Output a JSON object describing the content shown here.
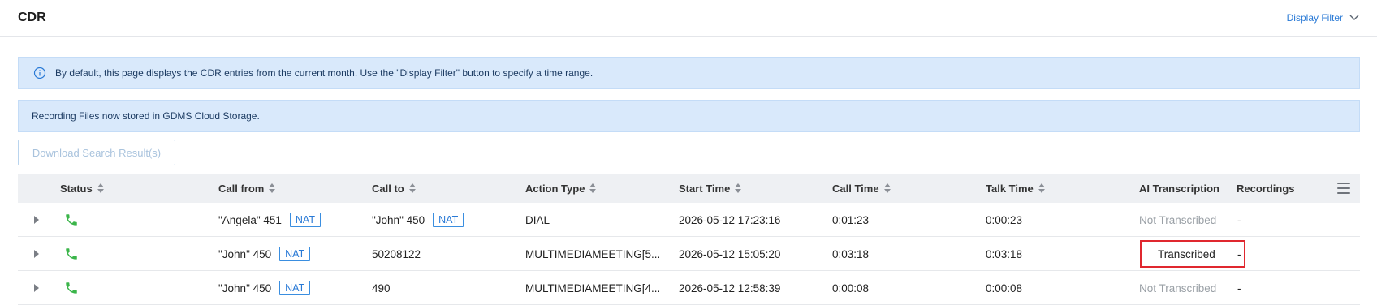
{
  "header": {
    "title": "CDR",
    "display_filter_label": "Display Filter"
  },
  "notices": {
    "default_range": "By default, this page displays the CDR entries from the current month. Use the \"Display Filter\" button to specify a time range.",
    "recording_storage": "Recording Files now stored in GDMS Cloud Storage."
  },
  "toolbar": {
    "download_label": "Download Search Result(s)"
  },
  "table": {
    "columns": {
      "status": "Status",
      "call_from": "Call from",
      "call_to": "Call to",
      "action_type": "Action Type",
      "start_time": "Start Time",
      "call_time": "Call Time",
      "talk_time": "Talk Time",
      "ai_transcription": "AI Transcription",
      "recordings": "Recordings"
    },
    "rows": [
      {
        "call_from": "\"Angela\" 451",
        "call_from_tag": "NAT",
        "call_to": "\"John\" 450",
        "call_to_tag": "NAT",
        "action_type": "DIAL",
        "start_time": "2026-05-12 17:23:16",
        "call_time": "0:01:23",
        "talk_time": "0:00:23",
        "ai_transcription": "Not Transcribed",
        "recordings": "-"
      },
      {
        "call_from": "\"John\" 450",
        "call_from_tag": "NAT",
        "call_to": "50208122",
        "action_type": "MULTIMEDIAMEETING[5...",
        "start_time": "2026-05-12 15:05:20",
        "call_time": "0:03:18",
        "talk_time": "0:03:18",
        "ai_transcription": "Transcribed",
        "recordings": "-"
      },
      {
        "call_from": "\"John\" 450",
        "call_from_tag": "NAT",
        "call_to": "490",
        "action_type": "MULTIMEDIAMEETING[4...",
        "start_time": "2026-05-12 12:58:39",
        "call_time": "0:00:08",
        "talk_time": "0:00:08",
        "ai_transcription": "Not Transcribed",
        "recordings": "-"
      }
    ]
  },
  "colors": {
    "accent": "#2a7ad6",
    "notice_bg": "#d9e9fb",
    "status_answered": "#3bb54a",
    "highlight": "#e0282f"
  },
  "icons": {
    "info": "info-icon",
    "status": "phone-icon",
    "filter_toggle": "chevron-down-icon",
    "columns_menu": "menu-icon"
  }
}
